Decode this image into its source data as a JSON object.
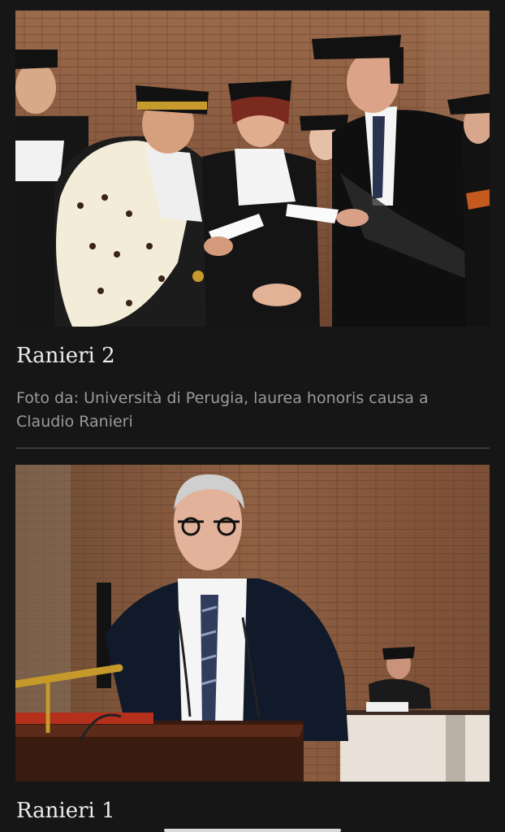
{
  "items": [
    {
      "title": "Ranieri 2",
      "caption": "Foto da: Università di Perugia, laurea honoris causa a Claudio Ranieri",
      "photo": "graduation-ceremony-photo"
    },
    {
      "title": "Ranieri 1",
      "photo": "speech-at-podium-photo"
    }
  ],
  "colors": {
    "background": "#161616",
    "title": "#ececec",
    "caption": "#9a9a9a",
    "divider": "#5a5a5a",
    "brick": "#8a5a3e"
  }
}
